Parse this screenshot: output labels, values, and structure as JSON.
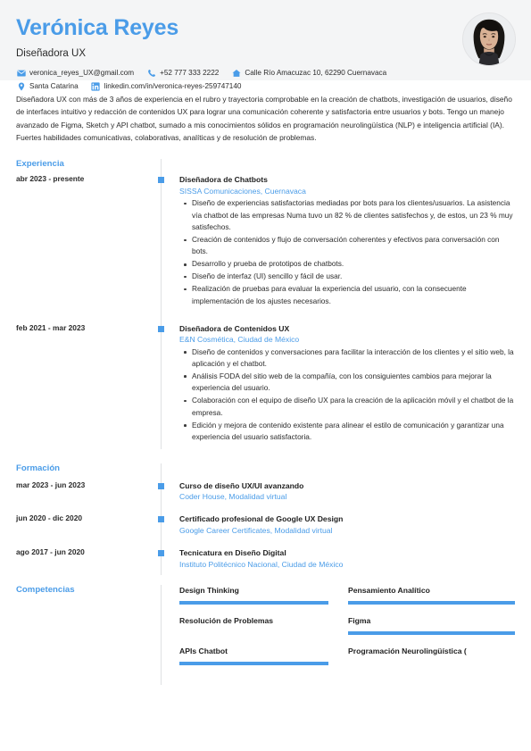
{
  "header": {
    "name": "Verónica Reyes",
    "job_title": "Diseñadora UX",
    "accent_color": "#4a9ce8",
    "band_color": "#f4f5f6",
    "avatar_alt": "avatar-photo",
    "contacts": [
      {
        "icon": "email-icon",
        "text": "veronica_reyes_UX@gmail.com"
      },
      {
        "icon": "phone-icon",
        "text": "+52 777 333 2222"
      },
      {
        "icon": "home-icon",
        "text": "Calle Río Amacuzac 10, 62290 Cuernavaca"
      },
      {
        "icon": "location-icon",
        "text": "Santa Catarina"
      },
      {
        "icon": "linkedin-icon",
        "text": "linkedin.com/in/veronica-reyes-259747140"
      }
    ]
  },
  "summary": {
    "text": "Diseñadora UX con más de 3 años de experiencia en el rubro y trayectoria comprobable en la creación de chatbots, investigación de usuarios, diseño de interfaces intuitivo y redacción de contenidos UX para lograr una comunicación coherente y satisfactoria entre usuarios y bots. Tengo un manejo avanzado de Figma, Sketch y API chatbot, sumado a mis conocimientos sólidos en programación neurolingüística (NLP) e inteligencia artificial (IA). Fuertes habilidades comunicativas, colaborativas, analíticas y de resolución de problemas."
  },
  "experience": {
    "title": "Experiencia",
    "entries": [
      {
        "date": "abr 2023 - presente",
        "role": "Diseñadora de Chatbots",
        "org": "SISSA Comunicaciones, Cuernavaca",
        "bullets": [
          "Diseño de experiencias satisfactorias mediadas por bots para los clientes/usuarios. La asistencia vía chatbot de las empresas Numa tuvo un 82 % de clientes satisfechos y, de estos, un 23 % muy satisfechos.",
          "Creación de contenidos y flujo de conversación coherentes y efectivos para conversación con bots.",
          "Desarrollo y prueba de prototipos de chatbots.",
          "Diseño de interfaz (UI) sencillo y fácil de usar.",
          "Realización de pruebas para evaluar la experiencia del usuario, con la consecuente implementación de los ajustes necesarios."
        ]
      },
      {
        "date": "feb 2021 - mar 2023",
        "role": "Diseñadora de Contenidos UX",
        "org": "E&N Cosmética, Ciudad de México",
        "bullets": [
          "Diseño de contenidos y conversaciones para facilitar la interacción de los clientes y el sitio web, la aplicación y el chatbot.",
          "Análisis FODA del sitio web de la compañía, con los consiguientes cambios para mejorar la experiencia del usuario.",
          "Colaboración con el equipo de diseño UX para la creación de la aplicación móvil y el chatbot de la empresa.",
          "Edición y mejora de contenido existente para alinear el estilo de comunicación y garantizar una experiencia del usuario satisfactoria."
        ]
      }
    ]
  },
  "education": {
    "title": "Formación",
    "entries": [
      {
        "date": "mar 2023 - jun 2023",
        "title": "Curso de diseño UX/UI avanzando",
        "school": "Coder House, Modalidad virtual"
      },
      {
        "date": "jun 2020 - dic 2020",
        "title": "Certificado profesional de Google UX Design",
        "school": "Google Career Certificates, Modalidad virtual"
      },
      {
        "date": "ago 2017 - jun 2020",
        "title": "Tecnicatura en Diseño Digital",
        "school": "Instituto Politécnico Nacional, Ciudad de México"
      }
    ]
  },
  "skills": {
    "title": "Competencias",
    "items": [
      {
        "label": "Design Thinking",
        "bar_visible": true,
        "column": "left"
      },
      {
        "label": "Pensamiento Analítico",
        "bar_visible": true,
        "column": "right"
      },
      {
        "label": "Resolución de Problemas",
        "bar_visible": false,
        "column": "left"
      },
      {
        "label": "Figma",
        "bar_visible": true,
        "column": "right"
      },
      {
        "label": "APIs Chatbot",
        "bar_visible": true,
        "column": "left"
      },
      {
        "label": "Programación Neurolingüística (",
        "bar_visible": false,
        "column": "right"
      }
    ]
  }
}
